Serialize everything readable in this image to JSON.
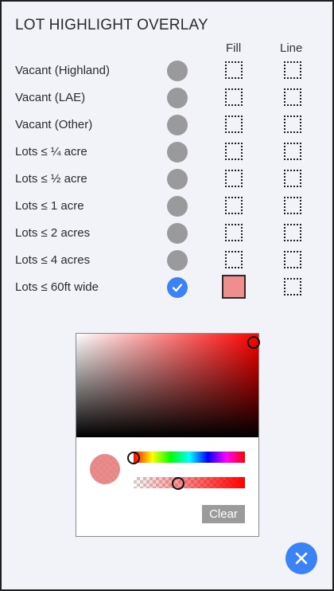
{
  "title": "LOT HIGHLIGHT OVERLAY",
  "columns": {
    "fill": "Fill",
    "line": "Line"
  },
  "rows": [
    {
      "label": "Vacant (Highland)",
      "checked": false
    },
    {
      "label": "Vacant (LAE)",
      "checked": false
    },
    {
      "label": "Vacant (Other)",
      "checked": false
    },
    {
      "label": "Lots ≤ ¼ acre",
      "checked": false
    },
    {
      "label": "Lots ≤ ½ acre",
      "checked": false
    },
    {
      "label": "Lots ≤ 1 acre",
      "checked": false
    },
    {
      "label": "Lots ≤ 2 acres",
      "checked": false
    },
    {
      "label": "Lots ≤ 4 acres",
      "checked": false
    },
    {
      "label": "Lots ≤ 60ft wide",
      "checked": true,
      "fill_color": "#f08d8d"
    }
  ],
  "color_picker": {
    "clear_label": "Clear",
    "hue_color": "#ff0000",
    "selected_color": "#e67878"
  },
  "colors": {
    "accent": "#3b82f6",
    "toggle_off": "#9a9a9c"
  },
  "icons": {
    "toggle_check": "check-icon",
    "close": "close-icon"
  }
}
